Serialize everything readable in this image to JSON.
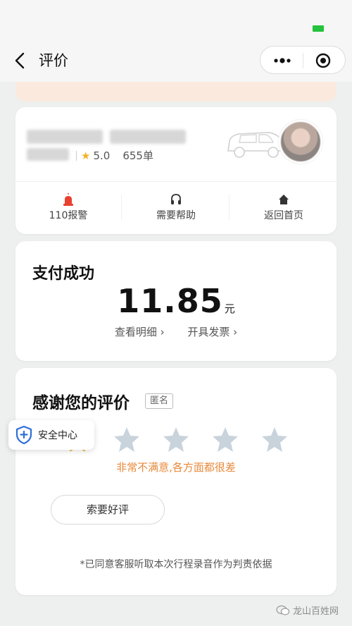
{
  "nav": {
    "title": "评价"
  },
  "driver": {
    "rating": "5.0",
    "orders": "655单"
  },
  "actions": [
    {
      "label": "110报警",
      "icon": "siren-icon",
      "color": "#e8412f"
    },
    {
      "label": "需要帮助",
      "icon": "headset-icon"
    },
    {
      "label": "返回首页",
      "icon": "home-icon"
    }
  ],
  "payment": {
    "title": "支付成功",
    "amount": "11.85",
    "unit": "元",
    "detail_link": "查看明细",
    "invoice_link": "开具发票"
  },
  "rating": {
    "title": "感谢您的评价",
    "anonymous_badge": "匿名",
    "stars_total": 5,
    "stars_selected": 1,
    "description": "非常不满意,各方面都很差",
    "request_good_button": "索要好评",
    "agreement_note": "*已同意客服听取本次行程录音作为判责依据"
  },
  "safety_center": {
    "label": "安全中心"
  },
  "watermark": {
    "text": "龙山百姓网"
  },
  "colors": {
    "accent_orange": "#e8893a",
    "star_gold": "#f2b32a",
    "star_inactive": "#c9d3dc",
    "alert_red": "#e8412f",
    "safety_blue": "#2f6fd6"
  }
}
